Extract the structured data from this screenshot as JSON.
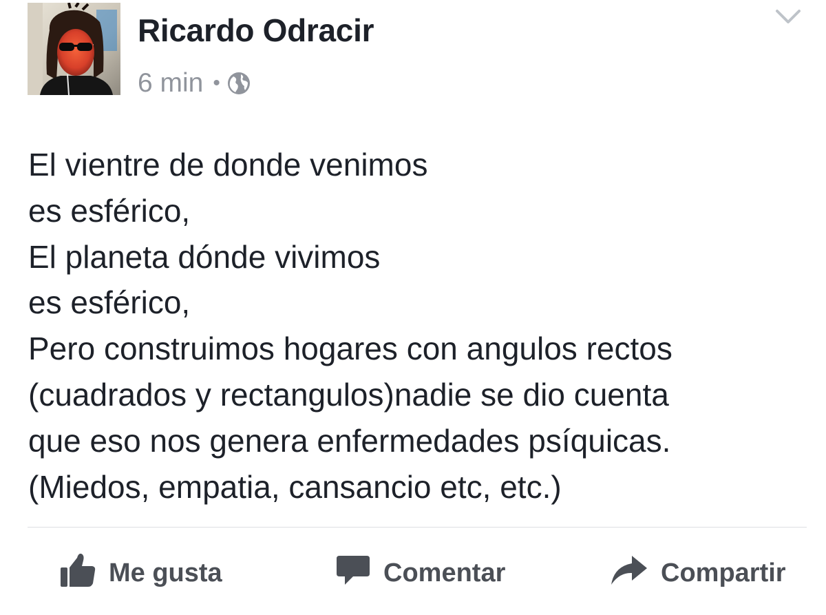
{
  "post": {
    "author": "Ricardo Odracir",
    "time": "6 min",
    "separator": "•",
    "privacy_icon": "globe-icon",
    "menu_icon": "chevron-down-icon",
    "avatar": "profile-photo",
    "lines": [
      "El vientre de donde venimos",
      "es esférico,",
      "El planeta dónde vivimos",
      "es esférico,",
      "Pero construimos hogares con angulos rectos",
      "(cuadrados y rectangulos)nadie se dio cuenta",
      "que eso nos genera enfermedades psíquicas.",
      "(Miedos, empatia, cansancio etc, etc.)"
    ]
  },
  "actions": {
    "like": {
      "label": "Me gusta",
      "icon": "thumbs-up-icon"
    },
    "comment": {
      "label": "Comentar",
      "icon": "comment-bubble-icon"
    },
    "share": {
      "label": "Compartir",
      "icon": "share-arrow-icon"
    }
  },
  "colors": {
    "text": "#1d2129",
    "meta": "#90949c",
    "action": "#4b4f56",
    "divider": "#dddfe2"
  }
}
